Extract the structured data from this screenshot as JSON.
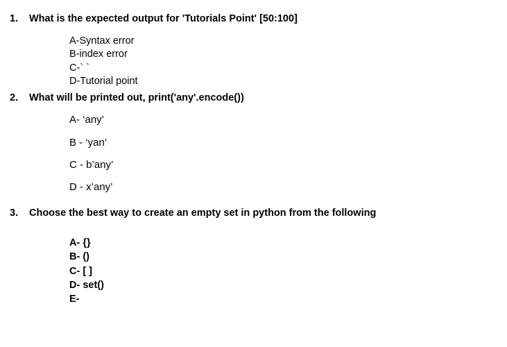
{
  "questions": [
    {
      "num": "1.",
      "text": "What is the expected output for  'Tutorials Point' [50:100]",
      "options": [
        "A-Syntax error",
        "B-index error",
        "C-` `",
        "D-Tutorial point"
      ]
    },
    {
      "num": "2.",
      "text": "What will be printed out, print('any'.encode())",
      "options": [
        "A- ‘any’",
        "B - ‘yan’",
        "C - b’any’",
        "D - x’any’"
      ]
    },
    {
      "num": "3.",
      "text": "Choose the best way to create an empty set in python from the following",
      "options": [
        "A-  {}",
        "B-  ()",
        "C-  [ ]",
        "D-  set()",
        "E-"
      ]
    }
  ]
}
